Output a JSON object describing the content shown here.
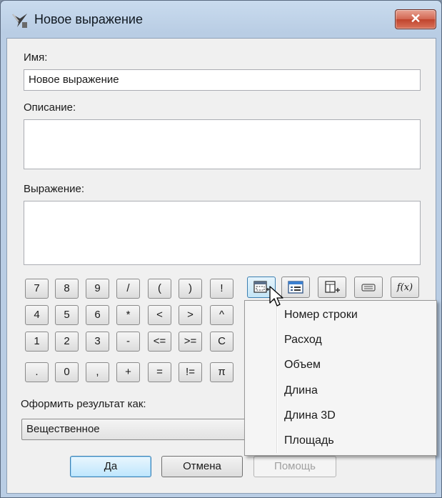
{
  "window": {
    "title": "Новое выражение",
    "close_glyph": "✕"
  },
  "form": {
    "name_label": "Имя:",
    "name_value": "Новое выражение",
    "description_label": "Описание:",
    "description_value": "",
    "expression_label": "Выражение:",
    "expression_value": ""
  },
  "keypad": {
    "row1": [
      "7",
      "8",
      "9",
      "/",
      "(",
      ")",
      "!"
    ],
    "row2": [
      "4",
      "5",
      "6",
      "*",
      "<",
      ">",
      "^"
    ],
    "row3": [
      "1",
      "2",
      "3",
      "-",
      "<=",
      ">=",
      "C"
    ],
    "row4": [
      ".",
      "0",
      ",",
      "+",
      "=",
      "!=",
      "π"
    ]
  },
  "toolbar": {
    "icons": [
      "insert-field-icon",
      "list-view-icon",
      "add-column-icon",
      "text-box-icon",
      "function-icon"
    ],
    "function_label": "f(x)"
  },
  "dropdown_menu": {
    "items": [
      "Номер строки",
      "Расход",
      "Объем",
      "Длина",
      "Длина 3D",
      "Площадь"
    ]
  },
  "result": {
    "label": "Оформить результат как:",
    "selected": "Вещественное"
  },
  "buttons": {
    "ok": "Да",
    "cancel": "Отмена",
    "help": "Помощь"
  },
  "colors": {
    "title_bar": "#b9cde4",
    "close_button": "#c0442d",
    "accent_border": "#3c7fb1"
  }
}
